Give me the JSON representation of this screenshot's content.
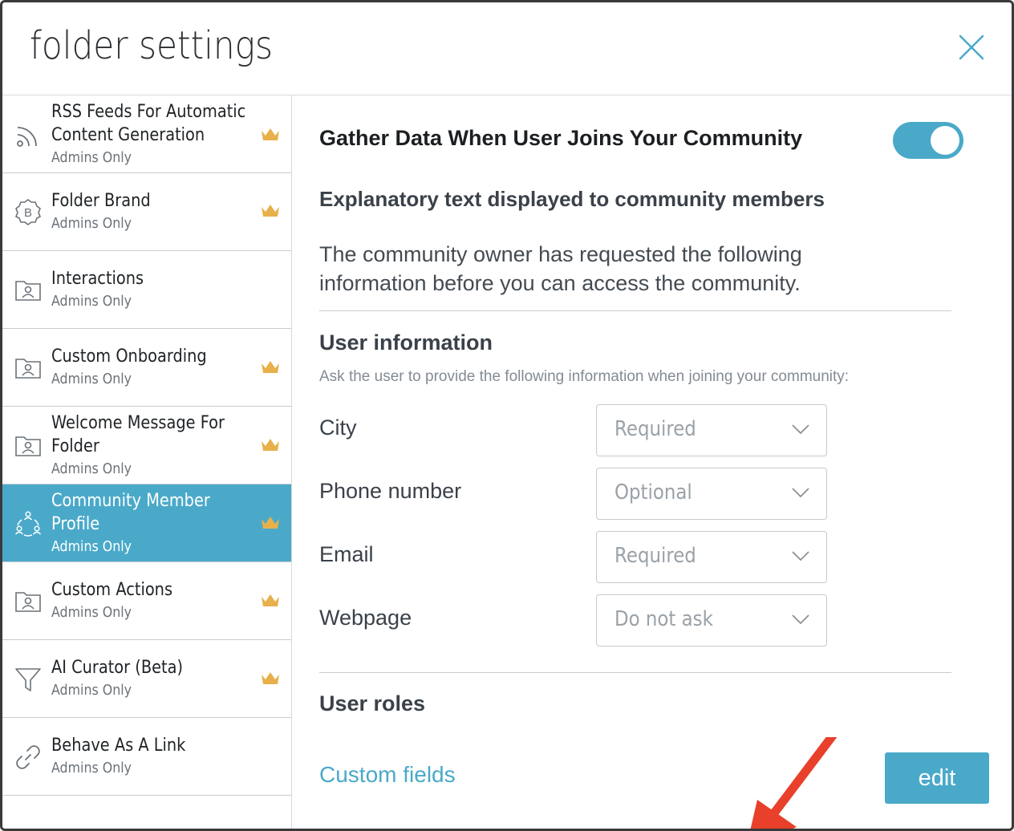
{
  "dialog": {
    "title": "folder settings",
    "close_icon": "close-icon"
  },
  "sidebar": {
    "items": [
      {
        "label1": "RSS Feeds For Automatic",
        "label2": "Content Generation",
        "sub": "Admins Only",
        "icon": "rss-icon",
        "crown": true,
        "active": false
      },
      {
        "label1": "Folder Brand",
        "label2": "",
        "sub": "Admins Only",
        "icon": "brand-icon",
        "crown": true,
        "active": false
      },
      {
        "label1": "Interactions",
        "label2": "",
        "sub": "Admins Only",
        "icon": "folder-user-icon",
        "crown": false,
        "active": false
      },
      {
        "label1": "Custom Onboarding",
        "label2": "",
        "sub": "Admins Only",
        "icon": "folder-user-icon",
        "crown": true,
        "active": false
      },
      {
        "label1": "Welcome Message For",
        "label2": "Folder",
        "sub": "Admins Only",
        "icon": "folder-user-icon",
        "crown": true,
        "active": false
      },
      {
        "label1": "Community Member",
        "label2": "Profile",
        "sub": "Admins Only",
        "icon": "community-icon",
        "crown": true,
        "active": true
      },
      {
        "label1": "Custom Actions",
        "label2": "",
        "sub": "Admins Only",
        "icon": "folder-user-icon",
        "crown": true,
        "active": false
      },
      {
        "label1": "AI Curator (Beta)",
        "label2": "",
        "sub": "Admins Only",
        "icon": "filter-icon",
        "crown": true,
        "active": false
      },
      {
        "label1": "Behave As A Link",
        "label2": "",
        "sub": "Admins Only",
        "icon": "link-icon",
        "crown": false,
        "active": false
      }
    ]
  },
  "main": {
    "gather_title": "Gather Data When User Joins Your Community",
    "toggle_on": true,
    "explain_title": "Explanatory text displayed to community members",
    "explain_text_line1": "The community owner has requested the following",
    "explain_text_line2": "information before you can access the community.",
    "user_info_title": "User information",
    "user_info_desc": "Ask the user to provide the following information when joining your community:",
    "fields": [
      {
        "label": "City",
        "value": "Required"
      },
      {
        "label": "Phone number",
        "value": "Optional"
      },
      {
        "label": "Email",
        "value": "Required"
      },
      {
        "label": "Webpage",
        "value": "Do not ask"
      }
    ],
    "user_roles_title": "User roles",
    "custom_fields_link": "Custom fields",
    "edit_button": "edit"
  },
  "colors": {
    "accent": "#4aa9c9",
    "crown": "#e8b04a",
    "annotation_arrow": "#e8402a"
  }
}
